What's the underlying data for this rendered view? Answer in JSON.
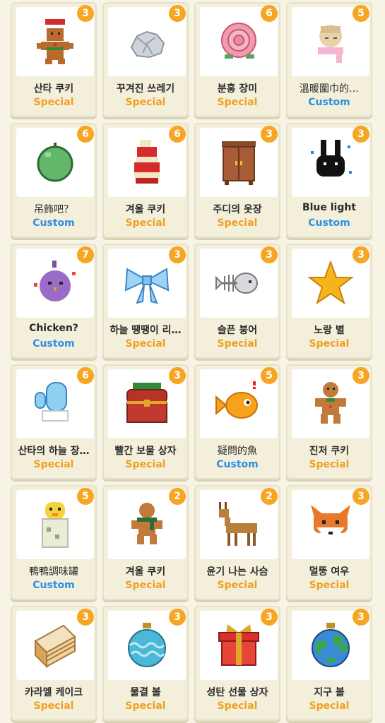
{
  "colors": {
    "badge": "#f6a623",
    "special": "#f0a020",
    "custom": "#2d8fe3"
  },
  "items": [
    {
      "name": "산타 쿠키",
      "count": "3",
      "tag": "Special",
      "icon": "santa-gingerbread-icon"
    },
    {
      "name": "꾸겨진 쓰레기",
      "count": "3",
      "tag": "Special",
      "icon": "crumpled-paper-icon"
    },
    {
      "name": "분홍 장미",
      "count": "6",
      "tag": "Special",
      "icon": "pink-rose-icon"
    },
    {
      "name": "溫暖圍巾的…",
      "count": "5",
      "tag": "Custom",
      "icon": "scarf-character-icon"
    },
    {
      "name": "吊飾吧？",
      "count": "6",
      "tag": "Custom",
      "icon": "green-ornament-icon"
    },
    {
      "name": "겨울 쿠키",
      "count": "6",
      "tag": "Special",
      "icon": "winter-cookie-icon"
    },
    {
      "name": "주디의 옷장",
      "count": "3",
      "tag": "Special",
      "icon": "wardrobe-icon"
    },
    {
      "name": "Blue light",
      "count": "3",
      "tag": "Custom",
      "icon": "black-bunny-icon"
    },
    {
      "name": "Chicken?",
      "count": "7",
      "tag": "Custom",
      "icon": "purple-chicken-icon"
    },
    {
      "name": "하늘 땡땡이 리…",
      "count": "3",
      "tag": "Special",
      "icon": "blue-ribbon-icon"
    },
    {
      "name": "슬픈 붕어",
      "count": "3",
      "tag": "Special",
      "icon": "fish-bone-icon"
    },
    {
      "name": "노랑 별",
      "count": "3",
      "tag": "Special",
      "icon": "yellow-star-icon"
    },
    {
      "name": "산타의 하늘 장…",
      "count": "6",
      "tag": "Special",
      "icon": "blue-mitten-icon"
    },
    {
      "name": "빨간 보물 상자",
      "count": "3",
      "tag": "Special",
      "icon": "treasure-chest-icon"
    },
    {
      "name": "疑問的魚",
      "count": "5",
      "tag": "Custom",
      "icon": "goldfish-icon"
    },
    {
      "name": "진저 쿠키",
      "count": "3",
      "tag": "Special",
      "icon": "ginger-cookie-icon"
    },
    {
      "name": "鴨鴨調味罐",
      "count": "5",
      "tag": "Custom",
      "icon": "duck-jar-icon"
    },
    {
      "name": "겨울 쿠키",
      "count": "2",
      "tag": "Special",
      "icon": "scarf-cookie-icon"
    },
    {
      "name": "윤기 나는 사슴",
      "count": "2",
      "tag": "Special",
      "icon": "deer-icon"
    },
    {
      "name": "멀뚱 여우",
      "count": "3",
      "tag": "Special",
      "icon": "fox-icon"
    },
    {
      "name": "카라멜 케이크",
      "count": "3",
      "tag": "Special",
      "icon": "caramel-cake-icon"
    },
    {
      "name": "물결 볼",
      "count": "3",
      "tag": "Special",
      "icon": "wave-bauble-icon"
    },
    {
      "name": "성탄 선물 상자",
      "count": "3",
      "tag": "Special",
      "icon": "gift-box-icon"
    },
    {
      "name": "지구 볼",
      "count": "3",
      "tag": "Special",
      "icon": "earth-bauble-icon"
    }
  ]
}
